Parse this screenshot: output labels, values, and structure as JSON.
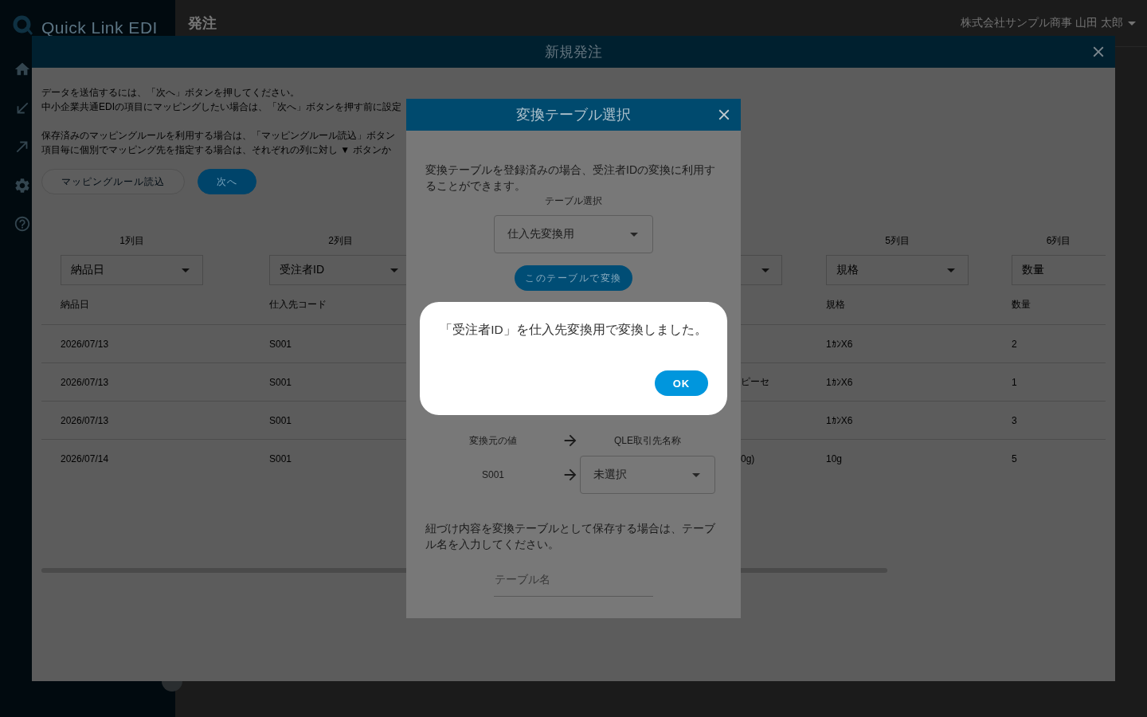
{
  "sidebar": {
    "logo": "Quick Link EDI"
  },
  "header": {
    "title": "発注",
    "user": "株式会社サンプル商事 山田 太郎"
  },
  "order_dialog": {
    "title": "新規発注",
    "instructions": [
      {
        "lines": [
          "データを送信するには、「次へ」ボタンを押してください。",
          "中小企業共通EDIの項目にマッピングしたい場合は、「次へ」ボタンを押す前に設定"
        ]
      },
      {
        "lines": [
          "保存済みのマッピングルールを利用する場合は、「マッピングルール読込」ボタン",
          "項目毎に個別でマッピング先を指定する場合は、それぞれの列に対し ▼ ボタンか"
        ]
      }
    ],
    "buttons": [
      {
        "label": "マッピングルール読込",
        "kind": "outline"
      },
      {
        "label": "次へ",
        "kind": "primary"
      }
    ],
    "table": {
      "columns": [
        {
          "kind": "full",
          "position": "1列目",
          "mapping": "納品日",
          "heading": "納品日"
        },
        {
          "kind": "full",
          "position": "2列目",
          "mapping": "受注者ID",
          "heading": "仕入先コード"
        },
        {
          "kind": "partial"
        },
        {
          "kind": "full",
          "position": "5列目",
          "mapping": "規格",
          "heading": "規格"
        },
        {
          "kind": "full",
          "position": "6列目",
          "mapping": "数量",
          "heading": "数量"
        }
      ],
      "rows": [
        {
          "cells": [
            "2026/07/13",
            "S001",
            "",
            "1ｶﾝX6",
            "2"
          ]
        },
        {
          "cells": [
            "2026/07/13",
            "S001",
            "ピーセ",
            "1ｶﾝX6",
            "1"
          ]
        },
        {
          "cells": [
            "2026/07/13",
            "S001",
            "",
            "1ｶﾝX6",
            "3"
          ]
        },
        {
          "cells": [
            "2026/07/14",
            "S001",
            "0g)",
            "10g",
            "5"
          ]
        }
      ]
    }
  },
  "table_dialog": {
    "title": "変換テーブル選択",
    "description": "変換テーブルを登録済みの場合、受注者IDの変換に利用することができます。",
    "table_select": {
      "label": "テーブル選択",
      "value": "仕入先変換用"
    },
    "convert_button": "このテーブルで変換",
    "mapping": {
      "source_heading": "変換元の値",
      "target_heading": "QLE取引先名称",
      "rows": [
        {
          "source": "S001",
          "target": "未選択"
        }
      ]
    },
    "save_note": "紐づけ内容を変換テーブルとして保存する場合は、テーブル名を入力してください。",
    "table_name": {
      "placeholder": "テーブル名"
    }
  },
  "alert": {
    "message": "「受注者ID」を仕入先変換用で変換しました。",
    "button": "OK"
  }
}
